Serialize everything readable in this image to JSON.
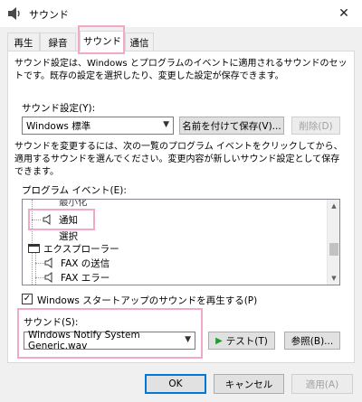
{
  "window": {
    "title": "サウンド",
    "close_glyph": "✕"
  },
  "tabs": [
    {
      "label": "再生"
    },
    {
      "label": "録音"
    },
    {
      "label": "サウンド"
    },
    {
      "label": "通信"
    }
  ],
  "description": "サウンド設定は、Windows とプログラムのイベントに適用されるサウンドのセットです。既存の設定を選択したり、変更した設定が保存できます。",
  "scheme": {
    "label": "サウンド設定(Y):",
    "value": "Windows 標準",
    "save_as_label": "名前を付けて保存(V)...",
    "delete_label": "削除(D)"
  },
  "instruction": "サウンドを変更するには、次の一覧のプログラム イベントをクリックしてから、適用するサウンドを選んでください。変更内容が新しいサウンド設定として保存できます。",
  "events": {
    "label": "プログラム イベント(E):",
    "items": [
      {
        "label": "最小化"
      },
      {
        "label": "通知"
      },
      {
        "label": "選択"
      },
      {
        "label": "エクスプローラー"
      },
      {
        "label": "FAX の送信"
      },
      {
        "label": "FAX エラー"
      }
    ]
  },
  "startup": {
    "checked_glyph": "✓",
    "label": "Windows スタートアップのサウンドを再生する(P)"
  },
  "sound": {
    "label": "サウンド(S):",
    "value": "Windows Notify System Generic.wav",
    "test_label": "テスト(T)",
    "browse_label": "参照(B)..."
  },
  "footer": {
    "ok_label": "OK",
    "cancel_label": "キャンセル",
    "apply_label": "適用(A)"
  },
  "colors": {
    "accent": "#0078d7",
    "highlight": "#f0a9c8",
    "test_arrow": "#1e9d35"
  }
}
